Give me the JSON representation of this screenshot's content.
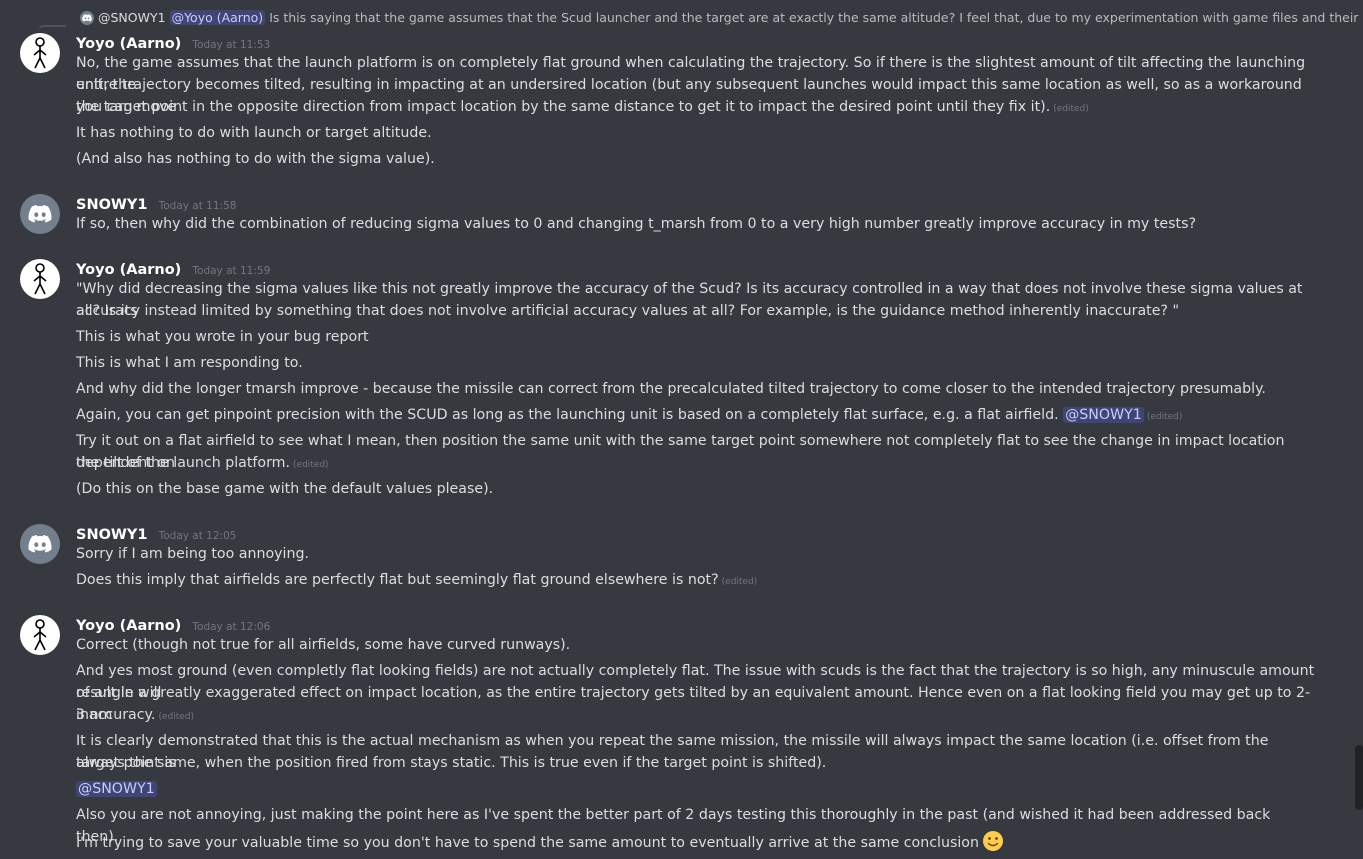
{
  "reply": {
    "author": "@SNOWY1",
    "mention": "@Yoyo (Aarno)",
    "text": "Is this saying that the game assumes that the Scud launcher and the target are at exactly the same altitude? I feel that, due to my experimentation with game files and their effect..."
  },
  "messages": [
    {
      "author": "Yoyo (Aarno)",
      "time": "Today at 11:53",
      "lines": [
        "No, the game assumes that the launch platform is on completely flat ground when calculating the trajectory. So if there is the slightest amount of tilt affecting the launching unit, the",
        "entire trajectory becomes tilted, resulting in impacting at an undersired location (but any subsequent launches would impact this same location as well, so as a workaround you can move",
        "the target point in the opposite direction from impact location by the same distance to get it to impact the desired point until they fix it).",
        "It has nothing to do with launch or target altitude.",
        "(And also has nothing to do with the sigma value)."
      ],
      "edited": "(edited)"
    },
    {
      "author": "SNOWY1",
      "time": "Today at 11:58",
      "lines": [
        "If so, then why did the combination of reducing sigma values to 0 and changing t_marsh from 0 to a very high number greatly improve accuracy in my tests?"
      ]
    },
    {
      "author": "Yoyo (Aarno)",
      "time": "Today at 11:59",
      "lines": [
        "\"Why did decreasing the sigma values like this not greatly improve the accuracy of the Scud? Is its accuracy controlled in a way that does not involve these sigma values at all? Is its",
        "accuracy instead limited by something that does not involve artificial accuracy values at all? For example, is the guidance method inherently inaccurate? \"",
        "This is what you wrote in your bug report",
        "This is what I am responding to.",
        "And why did the longer tmarsh improve - because the missile can correct from the precalculated tilted trajectory to come closer to the intended trajectory presumably.",
        "Again, you can get pinpoint precision with the SCUD as long as the launching unit is based on a completely flat surface, e.g. a flat airfield.",
        "Try it out on a flat airfield to see what I mean, then position the same unit with the same target point somewhere not completely flat to see the change in impact location dependent on",
        "the tilt of the launch platform.",
        "(Do this on the base game with the default values please)."
      ],
      "mention": "@SNOWY1",
      "edited": "(edited)"
    },
    {
      "author": "SNOWY1",
      "time": "Today at 12:05",
      "lines": [
        "Sorry if I am being too annoying.",
        "Does this imply that airfields are perfectly flat but seemingly flat ground elsewhere is not?"
      ],
      "edited": "(edited)"
    },
    {
      "author": "Yoyo (Aarno)",
      "time": "Today at 12:06",
      "lines": [
        "Correct (though not true for all airfields, some have curved runways).",
        "And yes most ground (even completly flat looking fields) are not actually completely flat. The issue with scuds is the fact that the trajectory is so high, any minuscule amount of angle will",
        "result in a greatly exaggerated effect on impact location, as the entire trajectory gets tilted by an equivalent amount. Hence even on a flat looking field you may get up to 2-3 nm",
        "inaccuracy.",
        "It is clearly demonstrated that this is the actual mechanism as when you repeat the same mission, the missile will always impact the same location (i.e. offset from the target point is",
        "always the same, when the position fired from stays static. This is true even if the target point is shifted).",
        "@SNOWY1",
        "Also you are not annoying, just making the point here as I've spent the better part of 2 days testing this thoroughly in the past (and wished it had been addressed back then).",
        "I'm trying to save your valuable time so you don't have to spend the same amount to eventually arrive at the same conclusion"
      ],
      "edited": "(edited)",
      "emoji": "slightly-smiling-face"
    }
  ],
  "colors": {
    "background": "#36393f",
    "text": "#dcddde",
    "author": "#ffffff",
    "timestamp": "#72767d",
    "mention_text": "#c9cdfb",
    "mention_bg": "#5865f24d",
    "discord_avatar": "#747f8d"
  },
  "icons": {
    "stick_avatar": "stick-figure-avatar-icon",
    "discord_avatar": "discord-logo-avatar-icon",
    "emoji": "slightly-smiling-face-emoji"
  }
}
